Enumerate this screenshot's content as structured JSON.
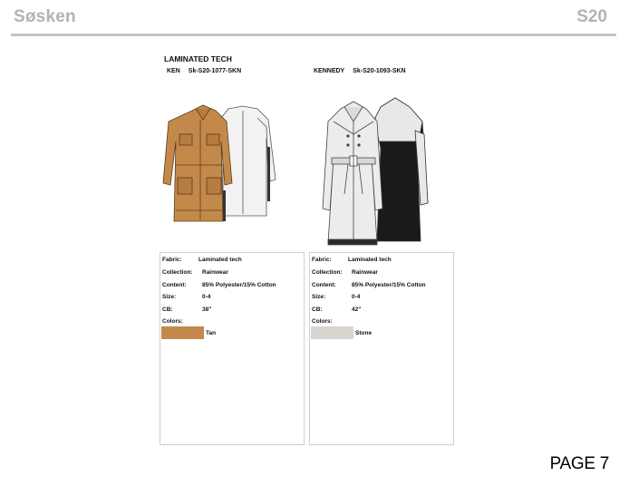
{
  "header": {
    "brand": "Søsken",
    "season": "S20"
  },
  "section_title": "LAMINATED TECH",
  "styles": [
    {
      "name": "KEN",
      "code": "Sk-S20-1077-SKN",
      "specs": {
        "fabric_label": "Fabric:",
        "fabric": "Laminated tech",
        "collection_label": "Collection:",
        "collection": "Rainwear",
        "content_label": "Content:",
        "content": "85% Polyester/15% Cotton",
        "size_label": "Size:",
        "size": "0-4",
        "cb_label": "CB:",
        "cb": "38\"",
        "colors_label": "Colors:"
      },
      "color_name": "Tan",
      "color_hex": "#c3894a"
    },
    {
      "name": "KENNEDY",
      "code": "Sk-S20-1093-SKN",
      "specs": {
        "fabric_label": "Fabric:",
        "fabric": "Laminated tech",
        "collection_label": "Collection:",
        "collection": "Rainwear",
        "content_label": "Content:",
        "content": "85% Polyester/15% Cotton",
        "size_label": "Size:",
        "size": "0-4",
        "cb_label": "CB:",
        "cb": "42\"",
        "colors_label": "Colors:"
      },
      "color_name": "Stone",
      "color_hex": "#d9d5d0"
    }
  ],
  "page_label": "PAGE 7"
}
